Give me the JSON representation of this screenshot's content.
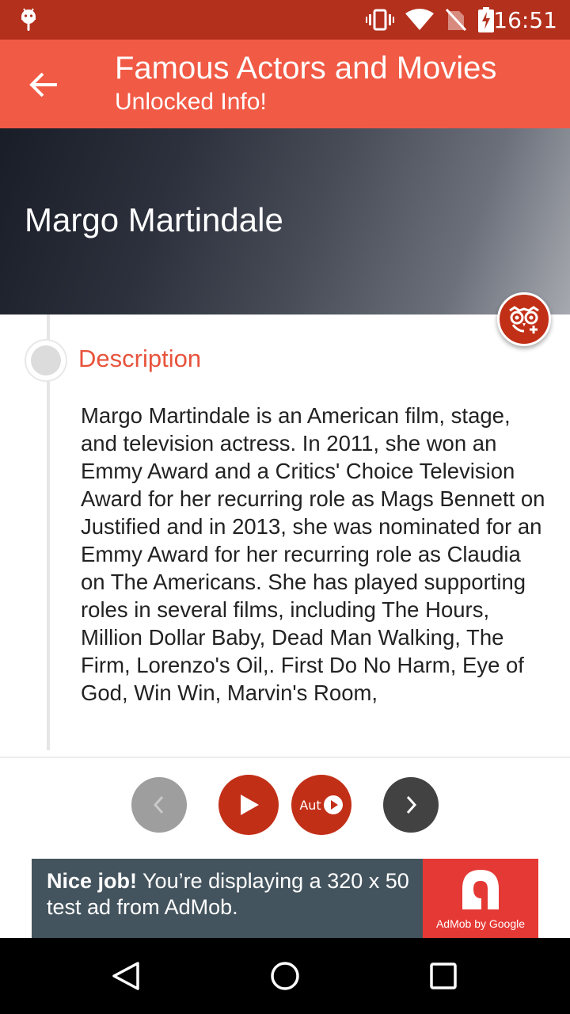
{
  "status_bar": {
    "time": "16:51"
  },
  "app_bar": {
    "title": "Famous Actors and Movies",
    "subtitle": "Unlocked Info!"
  },
  "hero": {
    "name": "Margo Martindale"
  },
  "section": {
    "title": "Description",
    "text": "Margo Martindale is an American film, stage, and television actress. In 2011, she won an Emmy Award and a Critics' Choice Television Award for her recurring role as Mags Bennett on Justified and in 2013, she was nominated for an Emmy Award for her recurring role as Claudia on The Americans. She has played supporting roles in several films, including The Hours, Million Dollar Baby, Dead Man Walking, The Firm, Lorenzo's Oil,. First Do No Harm, Eye of God, Win Win, Marvin's Room,"
  },
  "controls": {
    "auto_label": "Aut"
  },
  "ad": {
    "bold": "Nice job!",
    "text": " You’re displaying a 320 x 50 test ad from AdMob.",
    "brand": "AdMob by Google"
  },
  "colors": {
    "status_bar": "#b3301d",
    "app_bar": "#f15a45",
    "accent": "#c22f17",
    "section_title": "#e8533c"
  },
  "icons": [
    "android-icon",
    "vibrate-icon",
    "wifi-icon",
    "no-sim-icon",
    "battery-charging-icon",
    "back-arrow-icon",
    "owl-icon",
    "chevron-left-icon",
    "play-icon",
    "chevron-right-icon",
    "admob-logo-icon",
    "nav-back-icon",
    "nav-home-icon",
    "nav-recents-icon"
  ]
}
